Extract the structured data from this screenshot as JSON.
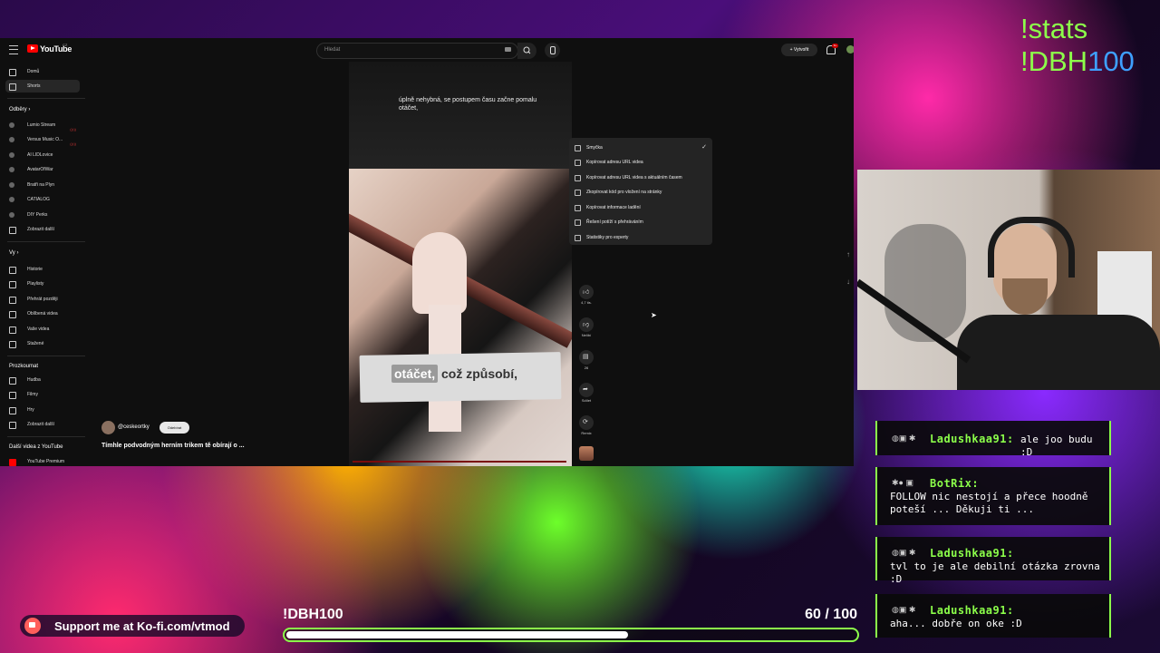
{
  "overlay": {
    "commands": [
      "!stats",
      "!DBH",
      "100"
    ],
    "kofi": "Support me at Ko-fi.com/vtmod",
    "goal": {
      "label": "!DBH100",
      "current": "60",
      "sep": "/",
      "target": "100",
      "progress_fraction": 0.6
    }
  },
  "youtube": {
    "logo_text": "YouTube",
    "country": "CZ",
    "search_placeholder": "Hledat",
    "create_label": "Vytvořit",
    "notif_count": "9+",
    "sidebar": {
      "items_top": [
        "Domů",
        "Shorts"
      ],
      "subs_heading": "Odběry",
      "subs": [
        "Lumio Stream",
        "Versus Music O...",
        "AI LIDLovice",
        "AvatarOfWar",
        "Bratři na Plyn",
        "CATIALOG",
        "DIY Perks",
        "Zobrazit další"
      ],
      "you_heading": "Vy",
      "you": [
        "Historie",
        "Playlisty",
        "Přehrát později",
        "Oblíbená videa",
        "Vaše videa",
        "Stažené"
      ],
      "explore_heading": "Prozkoumat",
      "explore": [
        "Hudba",
        "Filmy",
        "Hry",
        "Zobrazit další"
      ],
      "more_heading": "Další videa z YouTube",
      "more": [
        "YouTube Premium"
      ]
    },
    "video": {
      "caption": "úplně nehybná, se postupem času začne pomalu otáčet,",
      "subtitle_highlight": "otáčet,",
      "subtitle_rest": " což způsobí,",
      "channel": "@ceskeortky",
      "subscribe": "Odebírat",
      "title": "Tímhle podvodným herním trikem tě obírají o ..."
    },
    "actions": [
      {
        "icon": "like-icon",
        "label": "4,7 tis."
      },
      {
        "icon": "dislike-icon",
        "label": "Nelíbí"
      },
      {
        "icon": "comment-icon",
        "label": "26"
      },
      {
        "icon": "share-icon",
        "label": "Sdílet"
      },
      {
        "icon": "remix-icon",
        "label": "Remix"
      }
    ],
    "context_menu": [
      "Smyčka",
      "Kopírovat adresu URL videa",
      "Kopírovat adresu URL videa s aktuálním časem",
      "Zkopírovat kód pro vložení na stránky",
      "Kopírovat informace ladění",
      "Řešení potíží s přehráváním",
      "Statistiky pro experty"
    ]
  },
  "chat": [
    {
      "user": "Ladushkaa91:",
      "text": "ale joo budu :D"
    },
    {
      "user": "BotRix:",
      "text": "FOLLOW nic nestojí a přece hoodně poteší ... Děkuji ti ..."
    },
    {
      "user": "Ladushkaa91:",
      "text": "tvl to je ale debilní otázka zrovna :D"
    },
    {
      "user": "Ladushkaa91:",
      "text": "aha... dobře on oke :D"
    }
  ],
  "colors": {
    "accent_green": "#8cff4a",
    "accent_blue": "#3ea0ff",
    "yt_red": "#ff0000",
    "kofi": "#ff5e5b"
  }
}
